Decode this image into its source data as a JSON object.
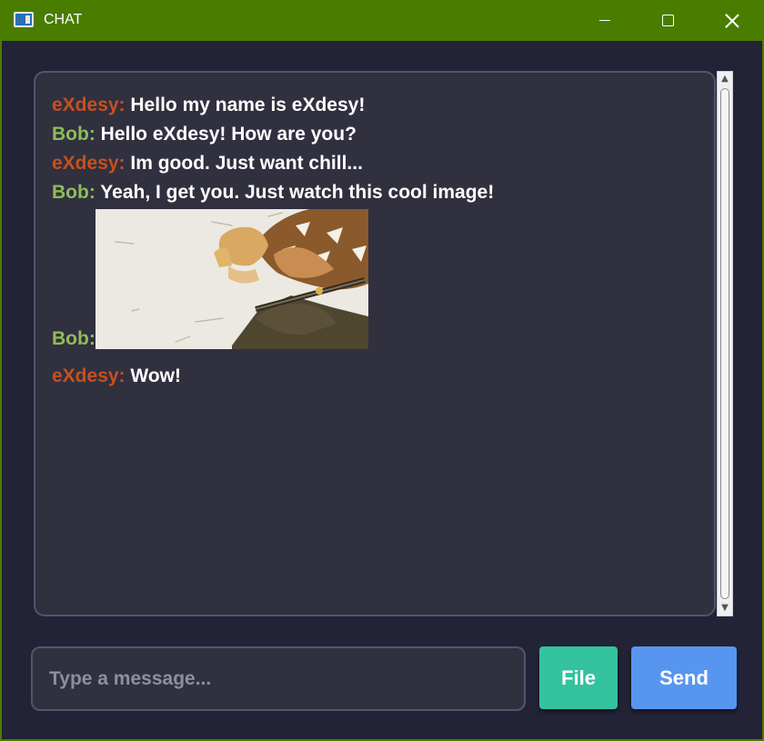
{
  "window": {
    "title": "CHAT",
    "icon": "app-window-icon",
    "controls": [
      "minimize-icon",
      "maximize-icon",
      "close-icon"
    ]
  },
  "colors": {
    "titlebar": "#4a7c00",
    "background": "#222336",
    "chat_area": "#30303f",
    "sender_exdesy": "#c8501c",
    "sender_bob": "#8fbc5a",
    "file_button": "#33c39e",
    "send_button": "#5796f0"
  },
  "messages": [
    {
      "sender": "eXdesy:",
      "text": "Hello my name is eXdesy!"
    },
    {
      "sender": "Bob:",
      "text": "Hello eXdesy! How are you?"
    },
    {
      "sender": "eXdesy:",
      "text": "Im good. Just want chill..."
    },
    {
      "sender": "Bob:",
      "text": "Yeah, I get you. Just watch this cool image!"
    },
    {
      "sender": "Bob:",
      "type": "image",
      "image": "anime-character-image"
    },
    {
      "sender": "eXdesy:",
      "text": "Wow!"
    }
  ],
  "composer": {
    "placeholder": "Type a message...",
    "value": "",
    "file_label": "File",
    "send_label": "Send"
  }
}
